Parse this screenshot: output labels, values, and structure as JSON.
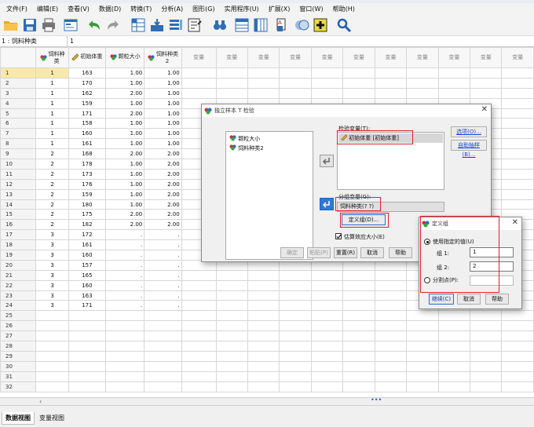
{
  "menu": [
    "文件(F)",
    "编辑(E)",
    "查看(V)",
    "数据(D)",
    "转换(T)",
    "分析(A)",
    "图形(G)",
    "实用程序(U)",
    "扩展(X)",
    "窗口(W)",
    "帮助(H)"
  ],
  "toolbar_icons": [
    "open-folder-icon",
    "save-icon",
    "print-icon",
    "dialog-recall-icon",
    "undo-icon",
    "redo-icon",
    "goto-case-icon",
    "goto-variable-icon",
    "variables-icon",
    "run-descriptives-icon",
    "find-icon",
    "insert-cases-icon",
    "insert-variable-icon",
    "split-file-icon",
    "weight-cases-icon",
    "select-cases-icon",
    "value-labels-icon",
    "search-icon"
  ],
  "cellref": {
    "name": "1 : 饲料种类",
    "value": "1"
  },
  "grid": {
    "columns": [
      "饲料种\n类",
      "初始体重",
      "颗粒大小",
      "饲料种类\n2",
      "变量",
      "变量",
      "变量",
      "变量",
      "变量",
      "变量",
      "变量",
      "变量",
      "变量",
      "变量",
      "变量"
    ],
    "rows": [
      [
        "1",
        "1",
        "163",
        "1.00",
        "1.00"
      ],
      [
        "2",
        "1",
        "170",
        "1.00",
        "1.00"
      ],
      [
        "3",
        "1",
        "162",
        "2.00",
        "1.00"
      ],
      [
        "4",
        "1",
        "159",
        "1.00",
        "1.00"
      ],
      [
        "5",
        "1",
        "171",
        "2.00",
        "1.00"
      ],
      [
        "6",
        "1",
        "158",
        "1.00",
        "1.00"
      ],
      [
        "7",
        "1",
        "160",
        "1.00",
        "1.00"
      ],
      [
        "8",
        "1",
        "161",
        "1.00",
        "1.00"
      ],
      [
        "9",
        "2",
        "168",
        "2.00",
        "2.00"
      ],
      [
        "10",
        "2",
        "178",
        "1.00",
        "2.00"
      ],
      [
        "11",
        "2",
        "173",
        "1.00",
        "2.00"
      ],
      [
        "12",
        "2",
        "176",
        "1.00",
        "2.00"
      ],
      [
        "13",
        "2",
        "159",
        "1.00",
        "2.00"
      ],
      [
        "14",
        "2",
        "180",
        "1.00",
        "2.00"
      ],
      [
        "15",
        "2",
        "175",
        "2.00",
        "2.00"
      ],
      [
        "16",
        "2",
        "182",
        "2.00",
        "2.00"
      ],
      [
        "17",
        "3",
        "172",
        ".",
        "."
      ],
      [
        "18",
        "3",
        "161",
        ".",
        "."
      ],
      [
        "19",
        "3",
        "160",
        ".",
        "."
      ],
      [
        "20",
        "3",
        "157",
        ".",
        "."
      ],
      [
        "21",
        "3",
        "165",
        ".",
        "."
      ],
      [
        "22",
        "3",
        "160",
        ".",
        "."
      ],
      [
        "23",
        "3",
        "163",
        ".",
        "."
      ],
      [
        "24",
        "3",
        "171",
        ".",
        "."
      ],
      [
        "25",
        "",
        "",
        "",
        ""
      ],
      [
        "26",
        "",
        "",
        "",
        ""
      ],
      [
        "27",
        "",
        "",
        "",
        ""
      ],
      [
        "28",
        "",
        "",
        "",
        ""
      ],
      [
        "29",
        "",
        "",
        "",
        ""
      ],
      [
        "30",
        "",
        "",
        "",
        ""
      ],
      [
        "31",
        "",
        "",
        "",
        ""
      ],
      [
        "32",
        "",
        "",
        "",
        ""
      ]
    ]
  },
  "tabs": {
    "data_view": "数据视图",
    "variable_view": "变量视图"
  },
  "ttest_dialog": {
    "title": "独立样本 T 检验",
    "source_vars": [
      "颗粒大小",
      "饲料种类2"
    ],
    "test_label": "检验变量(T):",
    "test_var": "初始体重 [初始体重]",
    "group_label": "分组变量(G):",
    "group_var": "饲料种类(? ?)",
    "define_groups": "定义组(D)...",
    "options": "选项(O)...",
    "bootstrap": "自助抽样(B)...",
    "effect_size": "估算效应大小(E)",
    "ok": "确定",
    "paste": "粘贴(P)",
    "reset": "重置(R)",
    "cancel": "取消",
    "help": "帮助"
  },
  "define_dialog": {
    "title": "定义组",
    "use_specified": "使用指定的值(U)",
    "group1_label": "组 1:",
    "group1_value": "1",
    "group2_label": "组 2:",
    "group2_value": "2",
    "cutpoint": "分割点(P):",
    "continue": "继续(C)",
    "cancel": "取消",
    "help": "帮助"
  }
}
